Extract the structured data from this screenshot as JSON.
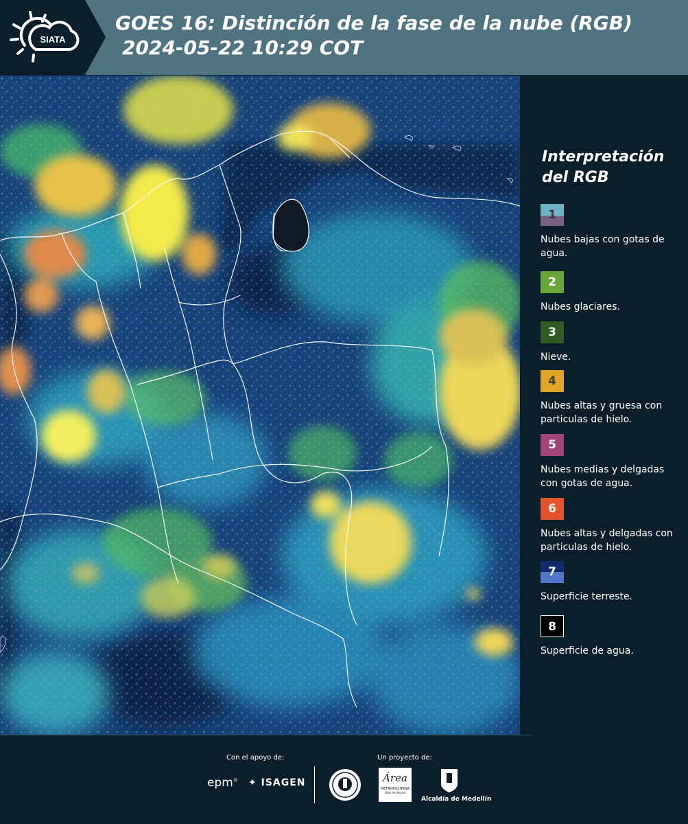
{
  "header": {
    "logo_text": "SIATA",
    "title_line1": "GOES 16: Distinción de la fase de la nube (RGB)",
    "title_line2": "2024-05-22 10:29 COT"
  },
  "legend": {
    "title_line1": "Interpretación",
    "title_line2": "del RGB",
    "items": [
      {
        "number": "1",
        "label": "Nubes bajas con gotas de agua.",
        "color_top": "#6fb2c4",
        "color_bottom": "#7a5f86"
      },
      {
        "number": "2",
        "label": "Nubes glaciares.",
        "color_top": "#6aa637",
        "color_bottom": "#6aa637"
      },
      {
        "number": "3",
        "label": "Nieve.",
        "color_top": "#2f5a22",
        "color_bottom": "#2f5a22"
      },
      {
        "number": "4",
        "label": "Nubes altas y gruesa con particulas de hielo.",
        "color_top": "#e0a524",
        "color_bottom": "#e0a524"
      },
      {
        "number": "5",
        "label": "Nubes medias y delgadas con gotas de agua.",
        "color_top": "#a4457a",
        "color_bottom": "#a4457a"
      },
      {
        "number": "6",
        "label": "Nubes altas y delgadas con particulas de hielo.",
        "color_top": "#e2542a",
        "color_bottom": "#e2542a"
      },
      {
        "number": "7",
        "label": "Superficie terreste.",
        "color_top": "#152a6a",
        "color_bottom": "#4f78c9"
      },
      {
        "number": "8",
        "label": "Superficie de agua.",
        "color_top": "#000000",
        "color_bottom": "#000000"
      }
    ]
  },
  "footer": {
    "support_label": "Con el apoyo de:",
    "project_label": "Un proyecto de:",
    "sponsor_epm": "epm",
    "sponsor_isagen": "ISAGEN",
    "area_text": "Área",
    "area_subtitle": "METROPOLITANA",
    "area_subtitle2": "Valle de Aburrá",
    "alcaldia": "Alcaldía de Medellín"
  },
  "colors": {
    "background": "#0b1f2b",
    "header_band": "#4f7381",
    "ocean": "#0d2547",
    "land": "#173c6e"
  }
}
